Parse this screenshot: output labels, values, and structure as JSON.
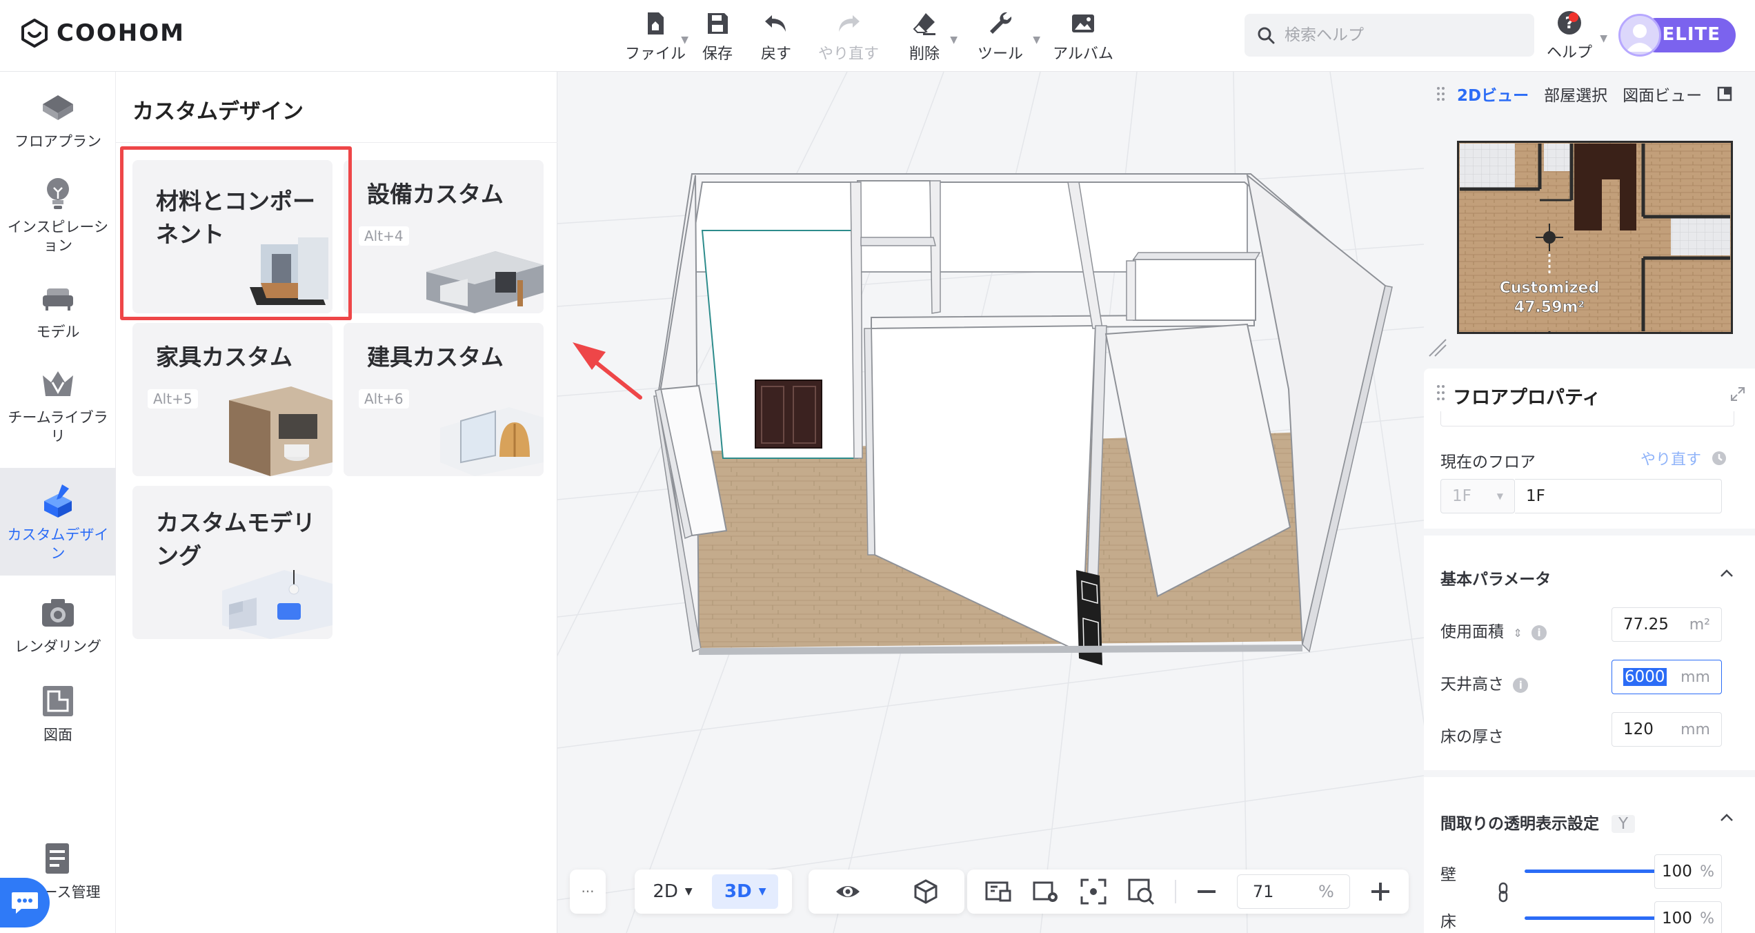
{
  "app": {
    "brand": "COOHOM"
  },
  "toolbar": {
    "file": "ファイル",
    "save": "保存",
    "undo": "戻す",
    "redo": "やり直す",
    "delete": "削除",
    "tools": "ツール",
    "album": "アルバム"
  },
  "search": {
    "placeholder": "検索ヘルプ"
  },
  "help": {
    "label": "ヘルプ"
  },
  "account": {
    "badge": "ELITE"
  },
  "leftnav": {
    "items": [
      {
        "label": "フロアプラン",
        "icon": "floorplan-icon"
      },
      {
        "label": "インスピレーション",
        "icon": "lightbulb-icon"
      },
      {
        "label": "モデル",
        "icon": "sofa-icon"
      },
      {
        "label": "チームライブラリ",
        "icon": "crown-icon"
      },
      {
        "label": "カスタムデザイン",
        "icon": "custom-design-icon"
      },
      {
        "label": "レンダリング",
        "icon": "camera-icon"
      },
      {
        "label": "図面",
        "icon": "drawing-icon"
      },
      {
        "label": "ース管理",
        "icon": "resource-manage-icon"
      }
    ]
  },
  "panel": {
    "title": "カスタムデザイン",
    "cards": [
      {
        "title": "材料とコンポーネント",
        "shortcut": ""
      },
      {
        "title": "設備カスタム",
        "shortcut": "Alt+4"
      },
      {
        "title": "家具カスタム",
        "shortcut": "Alt+5"
      },
      {
        "title": "建具カスタム",
        "shortcut": "Alt+6"
      },
      {
        "title": "カスタムモデリング",
        "shortcut": ""
      }
    ]
  },
  "viewport": {
    "mode_2d": "2D",
    "mode_3d": "3D",
    "more": "···",
    "zoom_value": "71",
    "zoom_unit": "%"
  },
  "minimap": {
    "tabs": [
      "2Dビュー",
      "部屋選択",
      "図面ビュー"
    ],
    "room_name": "Customized",
    "room_area": "47.59m²"
  },
  "properties": {
    "title": "フロアプロパティ",
    "current_floor_label": "現在のフロア",
    "redo_link": "やり直す",
    "floor_select": "1F",
    "floor_name": "1F",
    "basic_section": "基本パラメータ",
    "area_label": "使用面積",
    "area_value": "77.25",
    "area_unit": "m²",
    "ceiling_label": "天井高さ",
    "ceiling_value": "6000",
    "ceiling_unit": "mm",
    "floor_thickness_label": "床の厚さ",
    "floor_thickness_value": "120",
    "floor_thickness_unit": "mm",
    "transparency_section": "間取りの透明表示設定",
    "transparency_key": "Y",
    "wall_label": "壁",
    "wall_value": "100",
    "floor_label": "床",
    "floor_value": "100",
    "percent_unit": "%"
  },
  "colors": {
    "accent": "#2b6cf6",
    "highlight": "#ee4648",
    "elite": "#7b63ee",
    "floor_wood": "#c4ab8c"
  }
}
